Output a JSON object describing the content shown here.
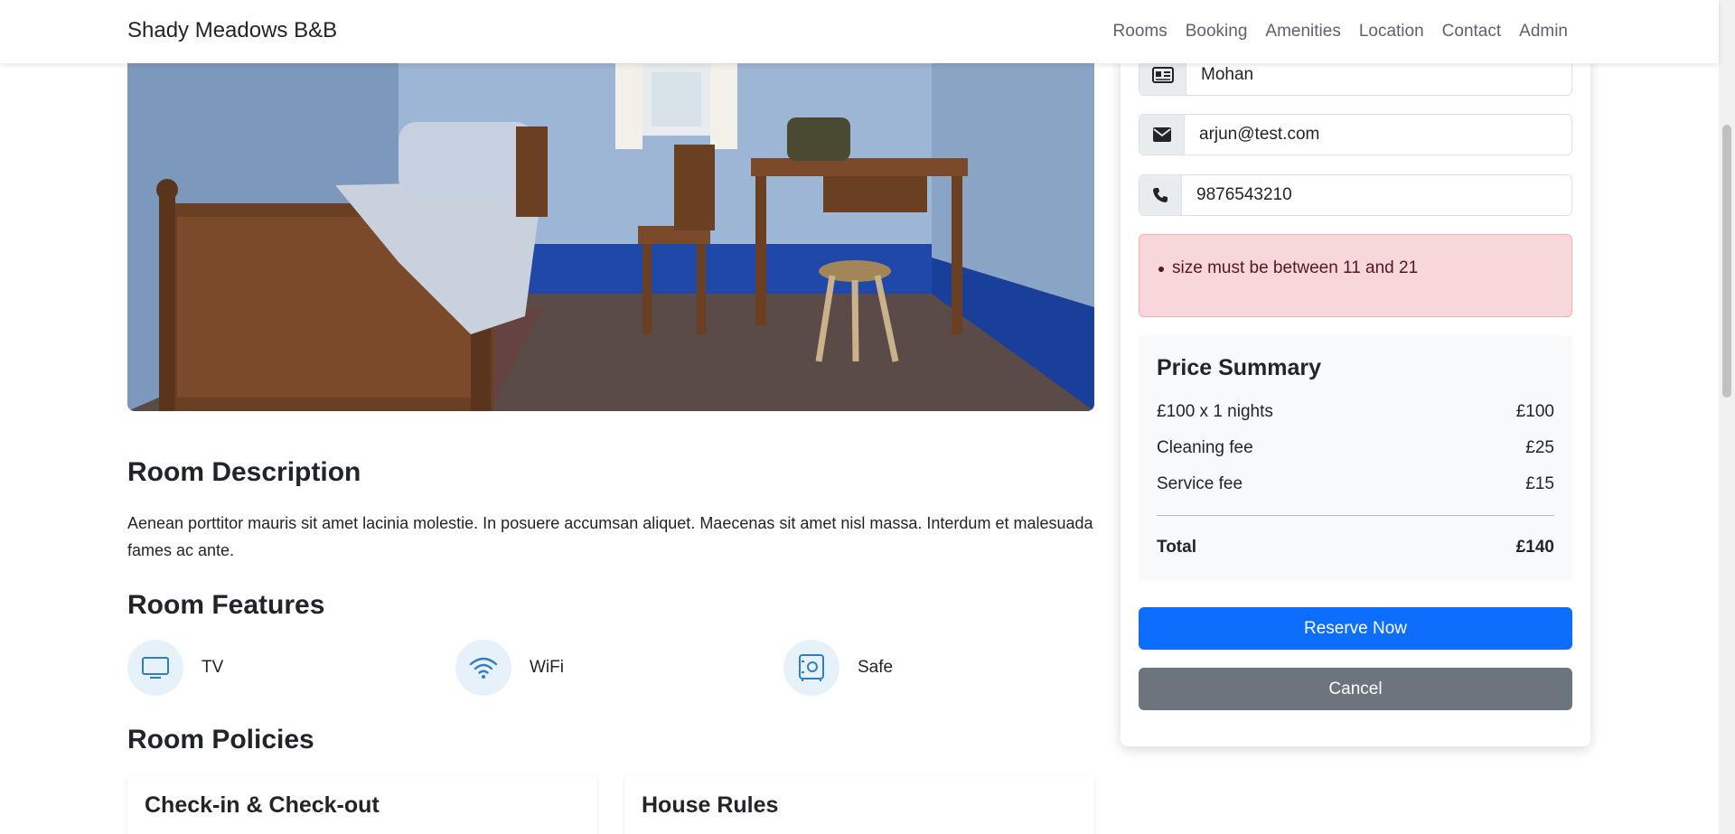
{
  "navbar": {
    "brand": "Shady Meadows B&B",
    "links": [
      "Rooms",
      "Booking",
      "Amenities",
      "Location",
      "Contact",
      "Admin"
    ]
  },
  "room": {
    "description_heading": "Room Description",
    "description": "Aenean porttitor mauris sit amet lacinia molestie. In posuere accumsan aliquet. Maecenas sit amet nisl massa. Interdum et malesuada fames ac ante.",
    "features_heading": "Room Features",
    "features": [
      {
        "label": "TV",
        "icon": "tv-icon"
      },
      {
        "label": "WiFi",
        "icon": "wifi-icon"
      },
      {
        "label": "Safe",
        "icon": "safe-icon"
      }
    ],
    "policies_heading": "Room Policies",
    "policies": [
      "Check-in & Check-out",
      "House Rules"
    ]
  },
  "booking": {
    "firstname": "Mohan",
    "email": "arjun@test.com",
    "phone": "9876543210",
    "error": "size must be between 11 and 21",
    "summary": {
      "title": "Price Summary",
      "rows": [
        {
          "label": "£100 x 1 nights",
          "value": "£100"
        },
        {
          "label": "Cleaning fee",
          "value": "£25"
        },
        {
          "label": "Service fee",
          "value": "£15"
        }
      ],
      "total_label": "Total",
      "total_value": "£140"
    },
    "reserve_label": "Reserve Now",
    "cancel_label": "Cancel"
  },
  "colors": {
    "primary": "#0d6efd",
    "secondary": "#6c757d",
    "danger_bg": "#f8d7da",
    "danger_text": "#58151c",
    "feature_bg": "#e7f1fa",
    "feature_icon": "#2f7fc0"
  }
}
